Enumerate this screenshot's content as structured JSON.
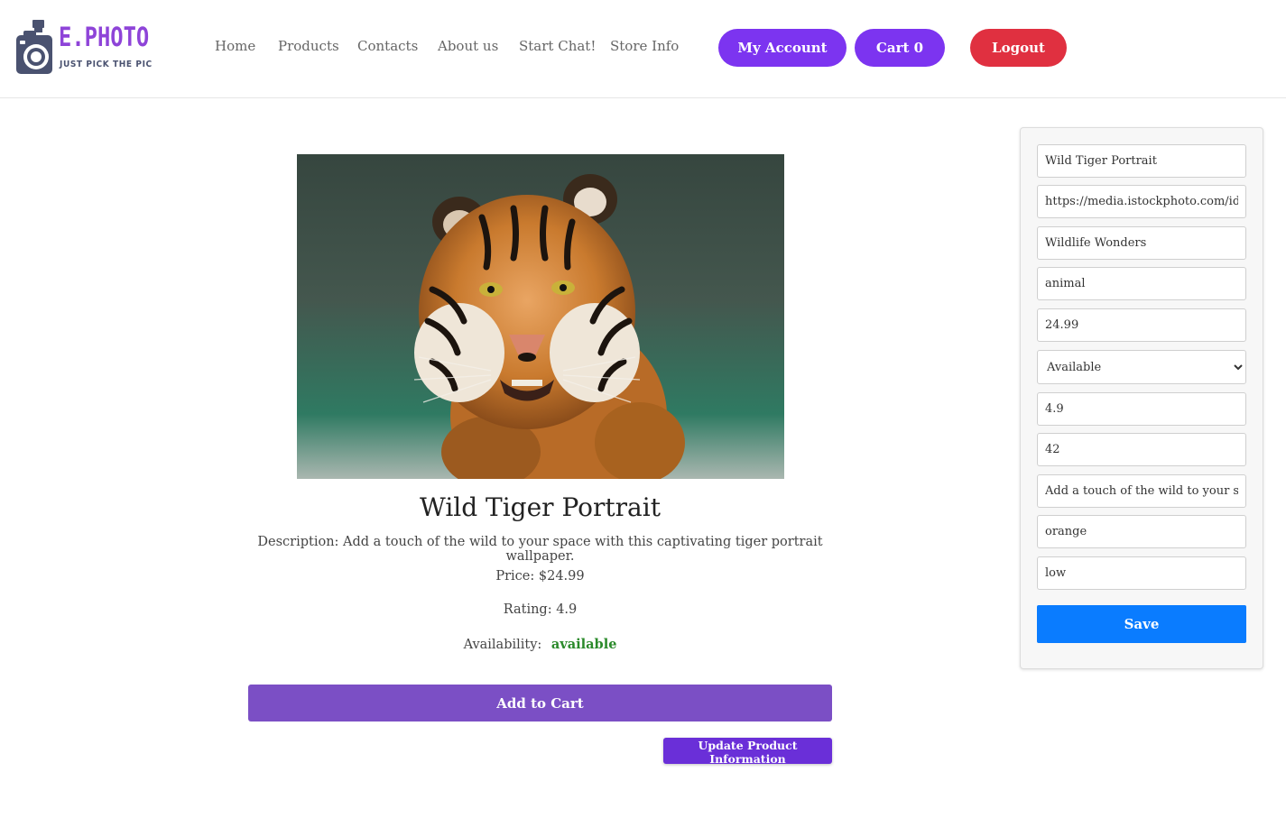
{
  "brand": {
    "name": "E.PHOTO",
    "tagline": "JUST PICK THE PIC",
    "accent": "#8e44d8"
  },
  "nav": {
    "items": [
      {
        "label": "Home"
      },
      {
        "label": "Products"
      },
      {
        "label": "Contacts"
      },
      {
        "label": "About us"
      },
      {
        "label": "Start Chat!"
      },
      {
        "label": "Store Info"
      }
    ],
    "my_account": "My Account",
    "cart": "Cart 0",
    "logout": "Logout"
  },
  "product": {
    "image_icon": "tiger-photo",
    "title": "Wild Tiger Portrait",
    "description": "Description: Add a touch of the wild to your space with this captivating tiger portrait wallpaper.",
    "price": "Price: $24.99",
    "rating": "Rating: 4.9",
    "availability_label": "Availability:",
    "availability_value": "available",
    "add_to_cart": "Add to Cart",
    "update_info": "Update Product Information"
  },
  "edit_form": {
    "name": "Wild Tiger Portrait",
    "image_url": "https://media.istockphoto.com/id/59",
    "collection": "Wildlife Wonders",
    "category": "animal",
    "price": "24.99",
    "availability_selected": "Available",
    "rating": "4.9",
    "stock": "42",
    "description": "Add a touch of the wild to your spac",
    "color": "orange",
    "popularity": "low",
    "save": "Save"
  },
  "colors": {
    "purple_button": "#7c34f0",
    "logout_red": "#e03040",
    "add_to_cart": "#7b4fc5",
    "save_blue": "#0a7cff",
    "available_green": "#2a8a2a"
  }
}
